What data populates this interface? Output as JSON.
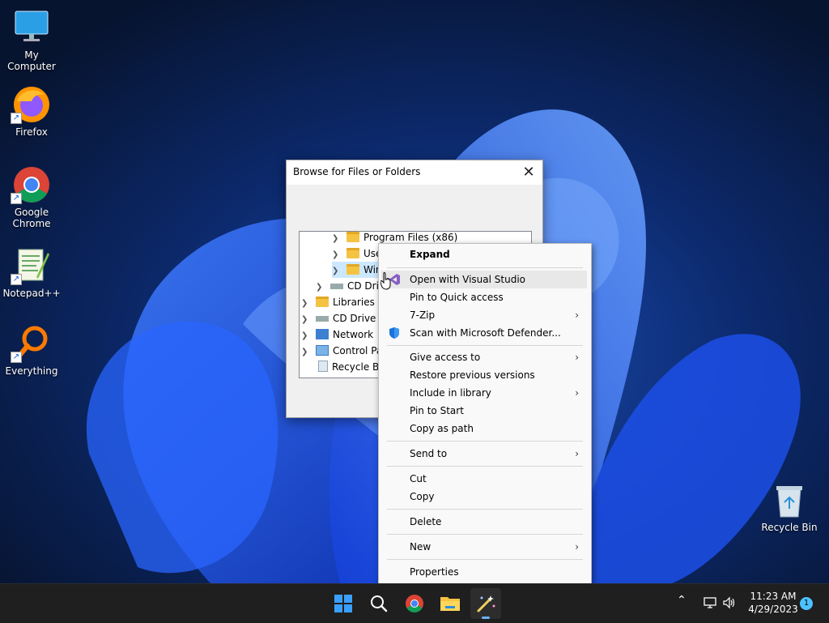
{
  "desktop": {
    "icons": [
      {
        "label": "My Computer",
        "icon": "monitor-icon"
      },
      {
        "label": "Firefox",
        "icon": "firefox-icon"
      },
      {
        "label": "Google Chrome",
        "icon": "chrome-icon"
      },
      {
        "label": "Notepad++",
        "icon": "notepadpp-icon"
      },
      {
        "label": "Everything",
        "icon": "search-magnifier-icon"
      }
    ],
    "recycle_bin": {
      "label": "Recycle Bin",
      "icon": "recycle-bin-icon"
    }
  },
  "dialog": {
    "title": "Browse for Files or Folders",
    "close_icon": "close-icon",
    "tree": [
      {
        "label": "Program Files (x86)",
        "icon": "folder-icon",
        "expandable": true
      },
      {
        "label": "Use",
        "icon": "folder-icon",
        "expandable": true
      },
      {
        "label": "Win",
        "icon": "folder-icon",
        "expandable": true,
        "selected": true
      },
      {
        "label": "CD Driv",
        "icon": "drive-icon",
        "expandable": true
      },
      {
        "label": "Libraries",
        "icon": "library-icon",
        "expandable": true
      },
      {
        "label": "CD Drive (D",
        "icon": "drive-icon",
        "expandable": true
      },
      {
        "label": "Network",
        "icon": "network-icon",
        "expandable": true
      },
      {
        "label": "Control Pan",
        "icon": "control-panel-icon",
        "expandable": true
      },
      {
        "label": "Recycle Bin",
        "icon": "recycle-bin-icon",
        "expandable": false
      }
    ]
  },
  "context_menu": {
    "items": [
      {
        "label": "Expand",
        "bold": true
      },
      {
        "label": "Open with Visual Studio",
        "icon": "visual-studio-icon",
        "hover": true
      },
      {
        "label": "Pin to Quick access"
      },
      {
        "label": "7-Zip",
        "submenu": true
      },
      {
        "label": "Scan with Microsoft Defender...",
        "icon": "defender-shield-icon"
      },
      {
        "label": "Give access to",
        "submenu": true
      },
      {
        "label": "Restore previous versions"
      },
      {
        "label": "Include in library",
        "submenu": true
      },
      {
        "label": "Pin to Start"
      },
      {
        "label": "Copy as path"
      },
      {
        "label": "Send to",
        "submenu": true
      },
      {
        "label": "Cut"
      },
      {
        "label": "Copy"
      },
      {
        "label": "Delete"
      },
      {
        "label": "New",
        "submenu": true
      },
      {
        "label": "Properties"
      }
    ],
    "submenu_glyph": "›"
  },
  "taskbar": {
    "apps": [
      "start-icon",
      "search-icon",
      "chrome-icon",
      "file-explorer-icon",
      "magic-wand-app-icon"
    ],
    "clock": {
      "time": "11:23 AM",
      "date": "4/29/2023"
    },
    "notification_count": "1",
    "tray_chevron": "^"
  },
  "colors": {
    "accent": "#0067c0",
    "wallpaper": "#0a1a3c",
    "taskbar": "#1f1f1f"
  }
}
